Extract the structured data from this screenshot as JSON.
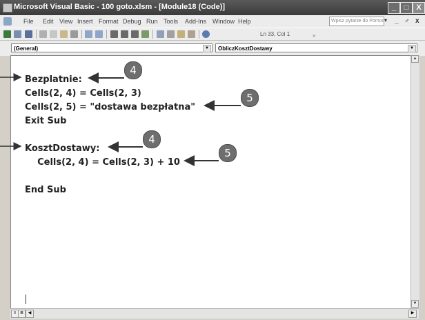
{
  "window": {
    "title": "Microsoft Visual Basic - 100 goto.xlsm - [Module18 (Code)]",
    "controls": [
      "_",
      "□",
      "X"
    ]
  },
  "menu": {
    "items": [
      "File",
      "Edit",
      "View",
      "Insert",
      "Format",
      "Debug",
      "Run",
      "Tools",
      "Add-Ins",
      "Window",
      "Help"
    ],
    "ask_placeholder": "Wpisz pytanie do Pomocy",
    "ask_dropdown": "▾",
    "mdi_controls": [
      "_",
      "♂",
      "x"
    ]
  },
  "toolbar": {
    "position_text": "Ln 33, Col 1",
    "chevron": "»"
  },
  "combos": {
    "object": "(General)",
    "procedure": "ObliczKosztDostawy"
  },
  "code": {
    "lines": [
      "Bezplatnie:",
      "Cells(2, 4) = Cells(2, 3)",
      "Cells(2, 5) = \"dostawa bezpłatna\"",
      "Exit Sub",
      "KosztDostawy:",
      "    Cells(2, 4) = Cells(2, 3) + 10",
      "End Sub"
    ]
  },
  "callouts": [
    "4",
    "5",
    "4",
    "5"
  ],
  "colors": {
    "titlebar": "#3b3b3b",
    "callout": "#6e6e6e",
    "code_text": "#222222"
  }
}
